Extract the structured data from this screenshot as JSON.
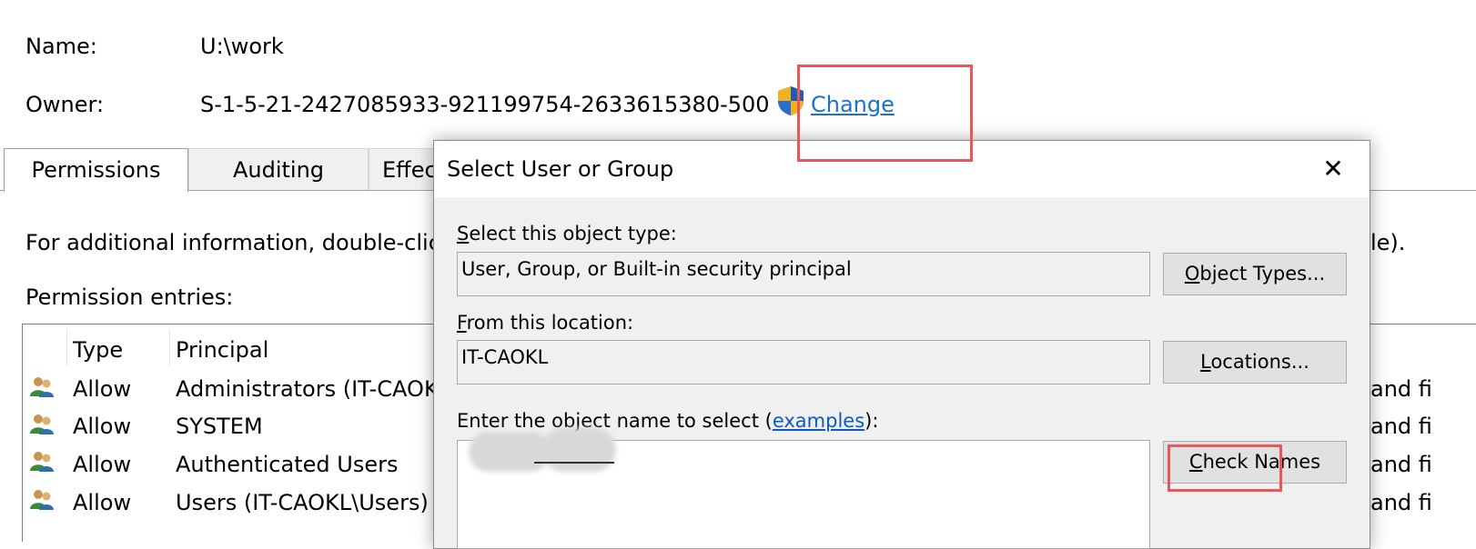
{
  "header": {
    "name_label": "Name:",
    "name_value": "U:\\work",
    "owner_label": "Owner:",
    "owner_value": "S-1-5-21-2427085933-921199754-2633615380-500",
    "change_link": "Change"
  },
  "tabs": [
    {
      "label": "Permissions",
      "active": true
    },
    {
      "label": "Auditing",
      "active": false
    },
    {
      "label": "Effect",
      "active": false
    }
  ],
  "info_text": "For additional information, double-click",
  "info_text_tail": "le).",
  "permission_entries_label": "Permission entries:",
  "table": {
    "columns": [
      "Type",
      "Principal"
    ],
    "rows": [
      {
        "type": "Allow",
        "principal": "Administrators (IT-CAOKL",
        "trailing": "and fi"
      },
      {
        "type": "Allow",
        "principal": "SYSTEM",
        "trailing": "and fi"
      },
      {
        "type": "Allow",
        "principal": "Authenticated Users",
        "trailing": "and fi"
      },
      {
        "type": "Allow",
        "principal": "Users (IT-CAOKL\\Users)",
        "trailing": "and fi"
      }
    ]
  },
  "dialog": {
    "title": "Select User or Group",
    "close_glyph": "✕",
    "object_type_label_first": "S",
    "object_type_label_rest": "elect this object type:",
    "object_type_value": "User, Group, or Built-in security principal",
    "object_types_button_first": "O",
    "object_types_button_rest": "bject Types...",
    "location_label_first": "F",
    "location_label_rest": "rom this location:",
    "location_value": "IT-CAOKL",
    "locations_button_first": "L",
    "locations_button_rest": "ocations...",
    "object_name_label_prefix": "Enter the object name to select (",
    "object_name_label_link": "examples",
    "object_name_label_suffix": "):",
    "check_names_button_first": "C",
    "check_names_button_rest": "heck Names"
  },
  "colors": {
    "accent_link": "#1a73c8",
    "annotation_red": "#e8585a",
    "dialog_bg": "#f0f0f0"
  },
  "icons": {
    "shield": "uac-shield-icon",
    "users": "users-icon",
    "close": "close-icon"
  }
}
